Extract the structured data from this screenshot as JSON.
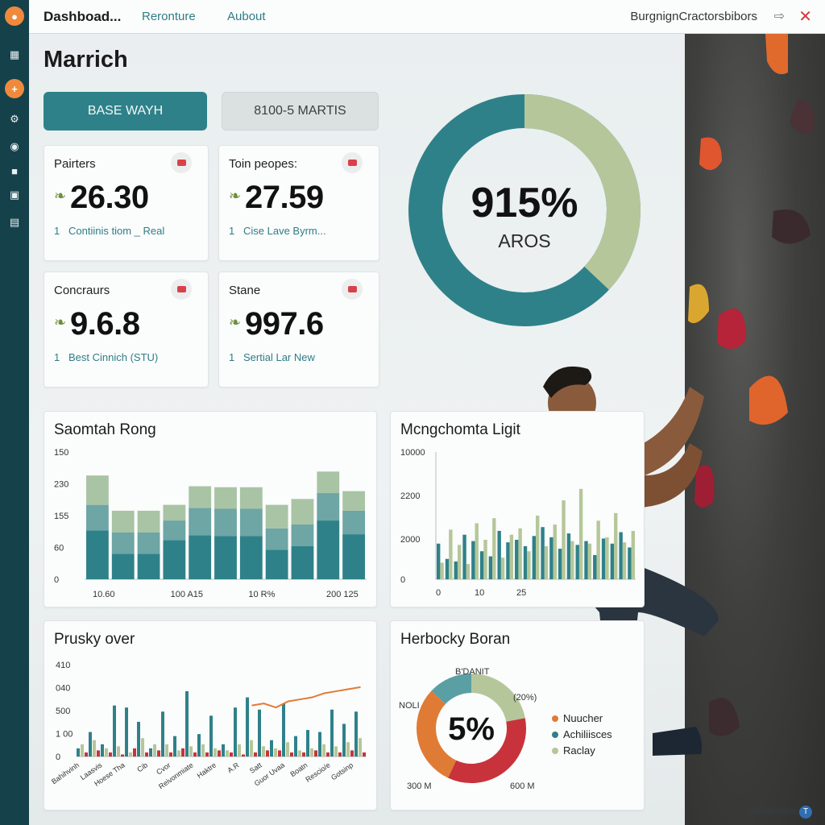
{
  "topbar": {
    "brand": "Dashboad...",
    "nav": [
      "Reronture",
      "Aubout"
    ],
    "breadcrumb": "BurgnignCractorsbibors",
    "arrow_icon": "arrow-right-icon",
    "close_icon": "close-icon"
  },
  "sidebar": {
    "items": [
      "logo-icon",
      "grid-icon",
      "add-icon",
      "gear-icon",
      "gamepad-icon",
      "folder-icon",
      "document-icon",
      "profile-icon"
    ]
  },
  "page": {
    "title": "Marrich"
  },
  "buttons": {
    "primary": "BASE WAYH",
    "secondary": "8100-5 MARTIS"
  },
  "stats": [
    {
      "label": "Pairters",
      "value": "26.30",
      "num": "1",
      "sub": "Contiinis tiom _ Real"
    },
    {
      "label": "Toin peopes:",
      "value": "27.59",
      "num": "1",
      "sub": "Cise Lave Byrm..."
    },
    {
      "label": "Concraurs",
      "value": "9.6.8",
      "num": "1",
      "sub": "Best Cinnich (STU)"
    },
    {
      "label": "Stane",
      "value": "997.6",
      "num": "1",
      "sub": "Sertial Lar New"
    }
  ],
  "big_donut": {
    "percent": "915%",
    "sublabel": "AROS",
    "colors": {
      "primary": "#2f8189",
      "secondary": "#b5c79a"
    }
  },
  "chart_data": [
    {
      "type": "bar",
      "title": "Saomtah Rong",
      "y_tick_labels": [
        "150",
        "230",
        "155",
        "60",
        "0"
      ],
      "x_tick_labels": [
        "10.60",
        "100 A15",
        "10 R%",
        "200 125"
      ],
      "stacked": true,
      "series": [
        {
          "values": [
            50,
            26,
            26,
            40,
            45,
            44,
            44,
            30,
            34,
            60,
            46
          ]
        },
        {
          "values": [
            26,
            22,
            22,
            20,
            28,
            28,
            28,
            22,
            22,
            28,
            24
          ]
        },
        {
          "values": [
            30,
            22,
            22,
            16,
            22,
            22,
            22,
            24,
            26,
            22,
            20
          ]
        }
      ],
      "colors": [
        "#2f8189",
        "#6ea5a5",
        "#a8c4a4"
      ],
      "ylim": [
        0,
        130
      ]
    },
    {
      "type": "bar",
      "title": "Mcngchomta Ligit",
      "y_tick_labels": [
        "10000",
        "2200",
        "2000",
        "0"
      ],
      "x_tick_labels": [
        "0",
        "10",
        "25"
      ],
      "ylim": [
        0,
        10000
      ],
      "series": [
        {
          "values": [
            2800,
            1600,
            1400,
            3500,
            3000,
            2200,
            1800,
            3800,
            2900,
            3100,
            2600,
            3400,
            4100,
            3300,
            2400,
            3600,
            2700,
            3000,
            1900,
            3200,
            2800,
            3700,
            2500
          ]
        },
        {
          "values": [
            1300,
            3900,
            2700,
            1200,
            4400,
            3100,
            4800,
            1700,
            3500,
            4000,
            2200,
            5000,
            2600,
            4300,
            6200,
            3000,
            7100,
            2800,
            4600,
            3300,
            5200,
            2900,
            3800
          ]
        }
      ],
      "colors": [
        "#2f8189",
        "#b5c79a"
      ]
    },
    {
      "type": "bar",
      "title": "Prusky over",
      "y_tick_labels": [
        "410",
        "040",
        "500",
        "1 00",
        "0"
      ],
      "x_tick_labels": [
        "Bahihvinh",
        "Laasvis",
        "Hoese Tha",
        "Cib",
        "Cvor",
        "Reivonmiate",
        "Haktre",
        "A.R",
        "Satt",
        "Guor Uvaa",
        "Boatn",
        "Rescio/e",
        "Gotsinp"
      ],
      "ylim": [
        0,
        450
      ],
      "series": [
        {
          "values": [
            40,
            120,
            60,
            250,
            240,
            170,
            40,
            220,
            100,
            320,
            110,
            200,
            60,
            240,
            290,
            230,
            80,
            260,
            100,
            130,
            120,
            230,
            160,
            220
          ]
        },
        {
          "values": [
            60,
            80,
            40,
            50,
            20,
            90,
            60,
            60,
            30,
            50,
            60,
            40,
            30,
            60,
            80,
            50,
            40,
            70,
            30,
            40,
            60,
            50,
            70,
            90
          ]
        },
        {
          "values": [
            20,
            30,
            20,
            10,
            40,
            20,
            30,
            20,
            40,
            20,
            20,
            30,
            20,
            10,
            20,
            30,
            30,
            20,
            20,
            30,
            20,
            20,
            30,
            20
          ]
        }
      ],
      "line": {
        "values": [
          null,
          null,
          null,
          null,
          null,
          null,
          null,
          null,
          null,
          null,
          null,
          null,
          null,
          null,
          250,
          260,
          240,
          270,
          280,
          290,
          310,
          320,
          330,
          340
        ]
      },
      "colors": [
        "#2f8189",
        "#b5c79a",
        "#c8333b",
        "#e07b35"
      ]
    },
    {
      "type": "pie",
      "title": "Herbocky Boran",
      "center_label": "5%",
      "slice_labels": [
        "B'DANIT",
        "(20%)",
        "NOLI",
        "300 M",
        "600 M"
      ],
      "legend": [
        "Nuucher",
        "Achiliisces",
        "Raclay"
      ],
      "slices": [
        {
          "value": 22,
          "color": "#b5c79a"
        },
        {
          "value": 35,
          "color": "#c8333b"
        },
        {
          "value": 30,
          "color": "#e07b35"
        },
        {
          "value": 13,
          "color": "#5a9fa3"
        }
      ],
      "legend_colors": [
        "#e07b35",
        "#2f8189",
        "#b5c79a"
      ]
    }
  ],
  "footer": {
    "credit": "Dashtooome",
    "credit_icon": "T"
  }
}
